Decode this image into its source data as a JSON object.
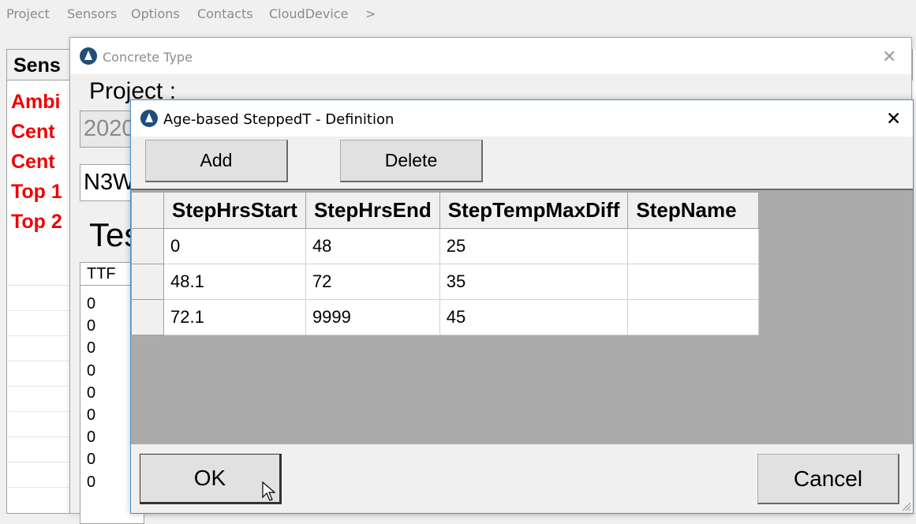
{
  "menu": {
    "items": [
      "Project",
      "Sensors",
      "Options",
      "Contacts",
      "CloudDevice",
      ">"
    ]
  },
  "main": {
    "sensor_header": "Sens",
    "sensors": [
      "Ambi",
      "Cent",
      "Cent",
      "Top 1",
      "Top 2"
    ]
  },
  "concrete_dialog": {
    "title": "Concrete Type",
    "project_label": "Project :",
    "field1_value": "2020",
    "field2_value": "N3W",
    "tes_label": "Tes",
    "grid_header": "TTF",
    "grid_values": [
      "0",
      "0",
      "0",
      "0",
      "0",
      "0",
      "0",
      "0",
      "0"
    ]
  },
  "age_dialog": {
    "title": "Age-based SteppedT - Definition",
    "add_label": "Add",
    "delete_label": "Delete",
    "columns": [
      "StepHrsStart",
      "StepHrsEnd",
      "StepTempMaxDiff",
      "StepName"
    ],
    "rows": [
      [
        "0",
        "48",
        "25",
        ""
      ],
      [
        "48.1",
        "72",
        "35",
        ""
      ],
      [
        "72.1",
        "9999",
        "45",
        ""
      ]
    ],
    "ok_label": "OK",
    "cancel_label": "Cancel"
  },
  "colors": {
    "sensor_text": "#ee0000",
    "grid_empty": "#ababab",
    "dialog_border": "#4a90c8"
  }
}
